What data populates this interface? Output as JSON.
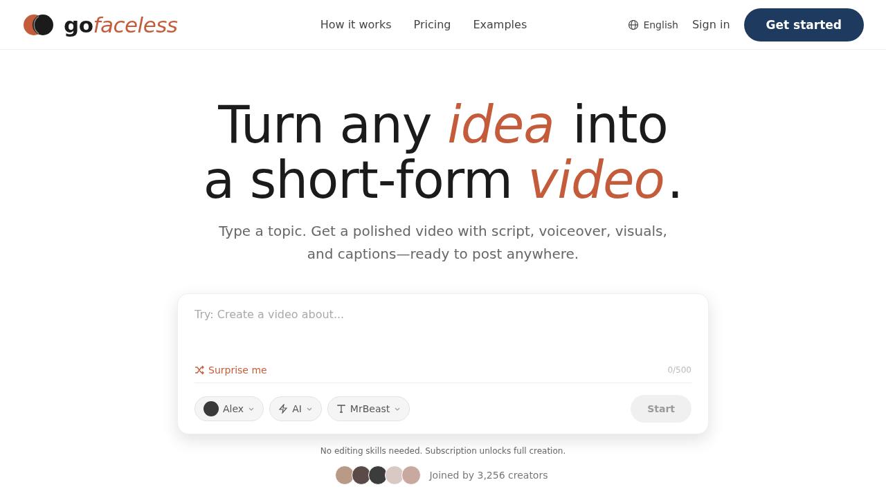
{
  "nav": {
    "logo": {
      "bold": "go",
      "italic": "faceless"
    },
    "links": [
      "How it works",
      "Pricing",
      "Examples"
    ],
    "language": "English",
    "sign_in": "Sign in",
    "cta": "Get started"
  },
  "hero": {
    "headline": [
      "Turn any *idea* into",
      "a short-form *video*."
    ],
    "subtitle": "Type a topic. Get a polished video with script, voiceover, visuals, and captions—ready to post anywhere."
  },
  "composer": {
    "placeholder": "Try: Create a video about...",
    "surprise": "Surprise me",
    "counter": "0/500",
    "chips": [
      {
        "kind": "avatar",
        "label": "Alex"
      },
      {
        "kind": "bolt",
        "label": "AI"
      },
      {
        "kind": "type",
        "label": "MrBeast"
      }
    ],
    "start": {
      "label": "Start",
      "disabled": true
    }
  },
  "note": "No editing skills needed. Subscription unlocks full creation.",
  "social": {
    "text": "Joined by 3,256 creators"
  }
}
